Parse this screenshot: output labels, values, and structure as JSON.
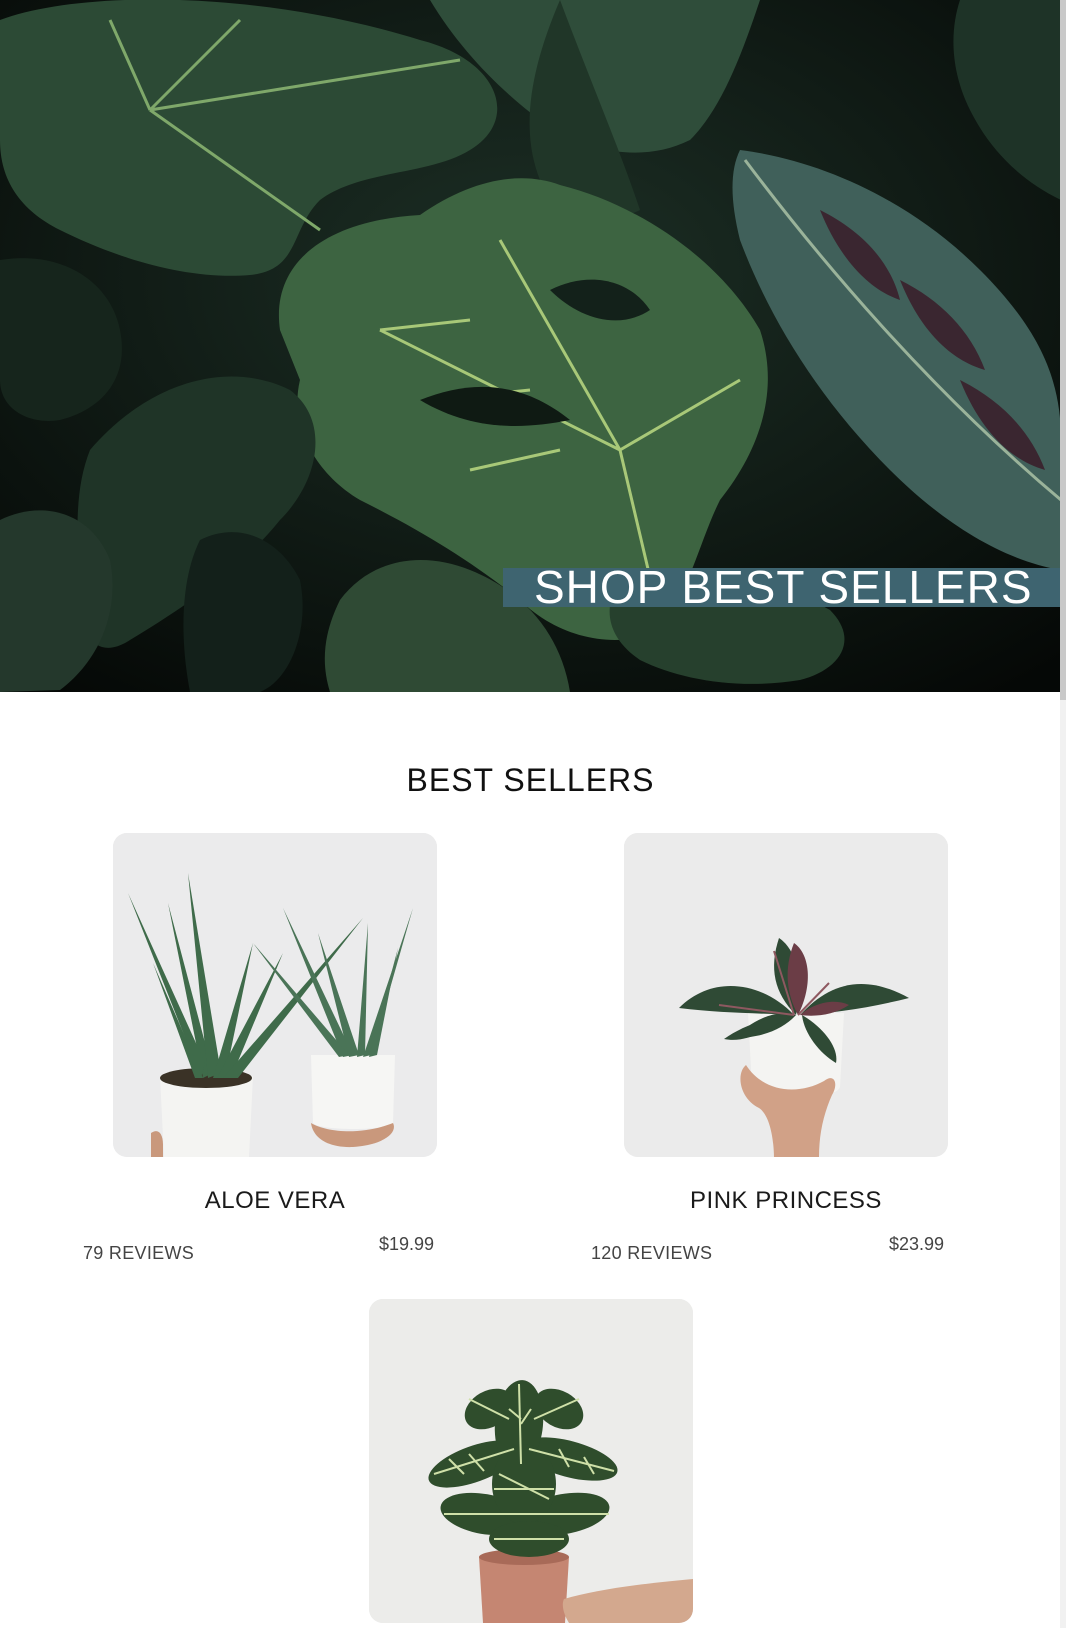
{
  "hero": {
    "cta_label": "SHOP BEST SELLERS"
  },
  "best_sellers": {
    "title": "BEST SELLERS",
    "products": [
      {
        "name": "ALOE VERA",
        "reviews": "79 REVIEWS",
        "price": "$19.99"
      },
      {
        "name": "PINK PRINCESS",
        "reviews": "120 REVIEWS",
        "price": "$23.99"
      },
      {
        "name": "",
        "reviews": "",
        "price": ""
      }
    ]
  },
  "colors": {
    "cta_background": "#3e6470",
    "hero_background": "#0b120e",
    "product_image_background": "#ebebeb",
    "text": "#111111"
  }
}
